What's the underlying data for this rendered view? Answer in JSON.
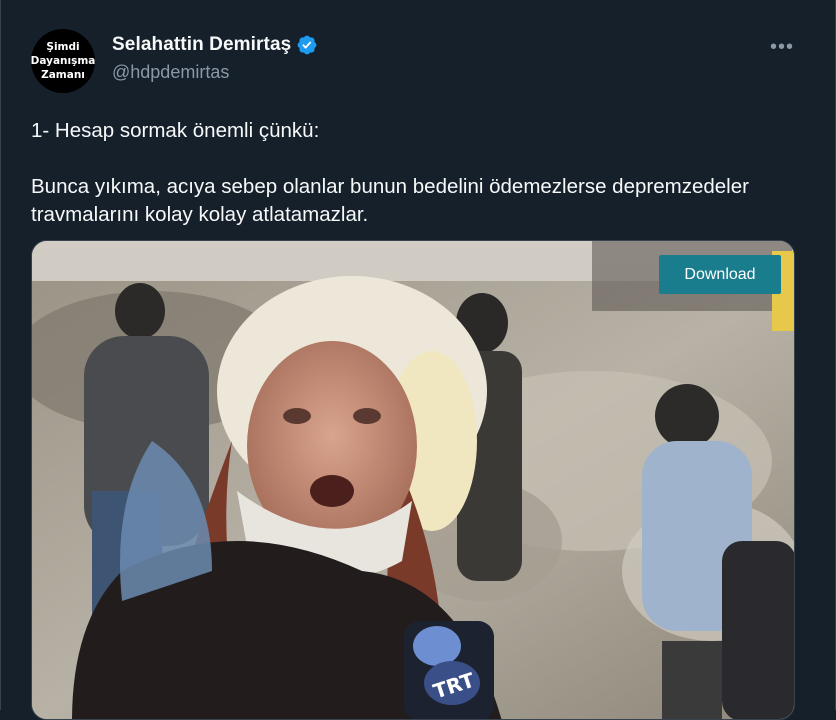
{
  "author": {
    "avatar_lines": [
      "Şimdi",
      "Dayanışma",
      "Zamanı"
    ],
    "display_name": "Selahattin Demirtaş",
    "handle": "@hdpdemirtas",
    "verified": true
  },
  "more_label": "•••",
  "tweet": {
    "paragraphs": [
      "1- Hesap sormak önemli çünkü:",
      "Bunca yıkıma, acıya sebep olanlar bunun bedelini ödemezlerse depremzedeler travmalarını kolay kolay atlatamazlar."
    ]
  },
  "media": {
    "type": "video",
    "mic_label": "TRT",
    "download_label": "Download"
  },
  "colors": {
    "background": "#15202b",
    "text": "#f7f9f9",
    "secondary": "#8b98a5",
    "verified": "#1d9bf0",
    "download_button": "#1a7d8e"
  }
}
